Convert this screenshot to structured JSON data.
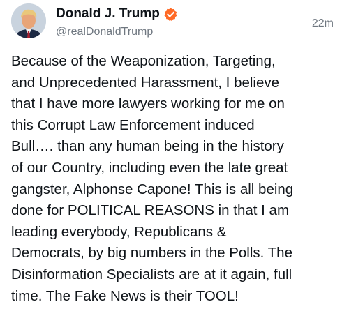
{
  "author": {
    "display_name": "Donald J. Trump",
    "handle": "@realDonaldTrump",
    "verified_icon": "verified-badge-icon",
    "verified_color": "#ff6a26",
    "avatar_icon": "avatar"
  },
  "post": {
    "timestamp": "22m",
    "text": "Because of the Weaponization, Targeting,\nand Unprecedented Harassment, I believe\nthat I have more lawyers working for me on\nthis Corrupt Law Enforcement induced\nBull…. than any human being in the history\nof our Country, including even the late great\ngangster, Alphonse Capone! This is all being\ndone for POLITICAL REASONS in that I am\nleading everybody, Republicans &\nDemocrats, by big numbers in the Polls. The\nDisinformation Specialists are at it again, full\ntime. The Fake News is their TOOL!"
  }
}
